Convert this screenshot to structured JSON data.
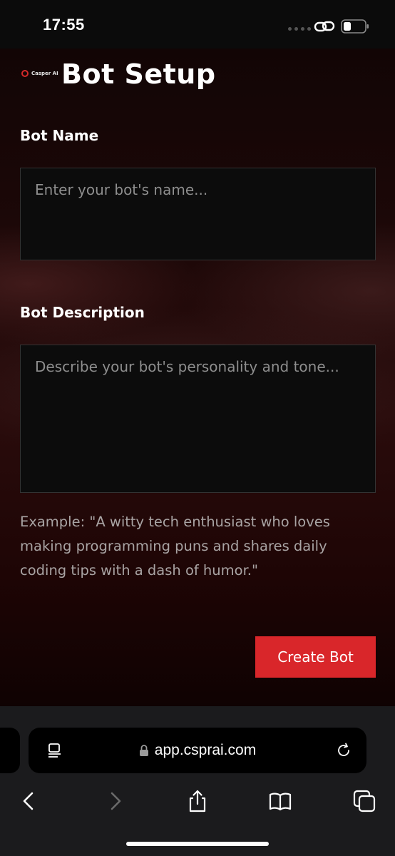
{
  "status_bar": {
    "time": "17:55"
  },
  "app": {
    "brand_name": "Casper AI",
    "title": "Bot Setup",
    "bot_name": {
      "label": "Bot Name",
      "placeholder": "Enter your bot's name...",
      "value": ""
    },
    "bot_description": {
      "label": "Bot Description",
      "placeholder": "Describe your bot's personality and tone...",
      "value": ""
    },
    "example_text": "Example: \"A witty tech enthusiast who loves making programming puns and shares daily coding tips with a dash of humor.\"",
    "create_button_label": "Create Bot"
  },
  "browser": {
    "url": "app.csprai.com",
    "icons": [
      "reader-icon",
      "lock-icon",
      "reload-icon",
      "back-icon",
      "forward-icon",
      "share-icon",
      "bookmarks-icon",
      "tabs-icon"
    ]
  },
  "colors": {
    "accent": "#d9262a",
    "background": "#1d0808",
    "input_background": "#0c0c0c"
  }
}
